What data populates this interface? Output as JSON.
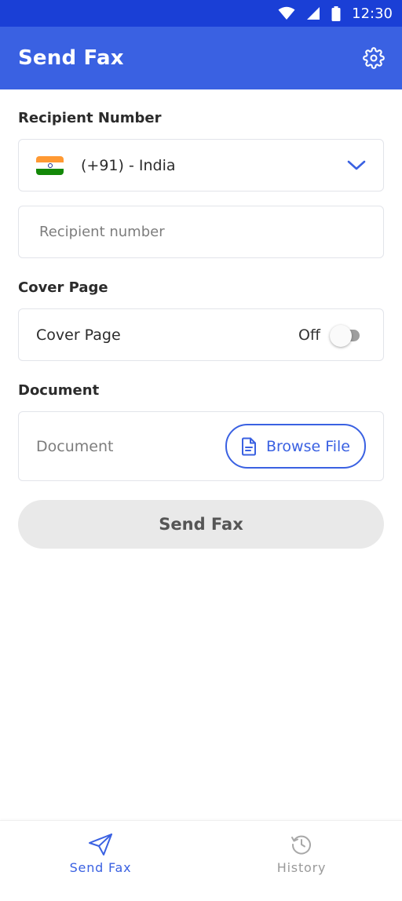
{
  "status_bar": {
    "time": "12:30",
    "icons": [
      "wifi-icon",
      "signal-icon",
      "battery-icon"
    ]
  },
  "app_bar": {
    "title": "Send Fax",
    "settings_icon": "gear-icon"
  },
  "recipient": {
    "section_label": "Recipient Number",
    "country": {
      "label": "(+91) - India",
      "flag": "india-flag-icon",
      "flag_colors": [
        "#ff9933",
        "#ffffff",
        "#138808"
      ]
    },
    "number_placeholder": "Recipient number"
  },
  "cover_page": {
    "section_label": "Cover Page",
    "label": "Cover Page",
    "state": "Off"
  },
  "document": {
    "section_label": "Document",
    "label": "Document",
    "browse_label": "Browse File"
  },
  "send_button": {
    "label": "Send Fax"
  },
  "bottom_nav": {
    "items": [
      {
        "label": "Send Fax",
        "icon": "send-icon",
        "active": true
      },
      {
        "label": "History",
        "icon": "history-icon",
        "active": false
      }
    ]
  },
  "colors": {
    "status_bar": "#1a3fd6",
    "accent": "#3a61e2",
    "disabled_button": "#e9e9e9",
    "toggle_off": "#9e9e9e"
  }
}
